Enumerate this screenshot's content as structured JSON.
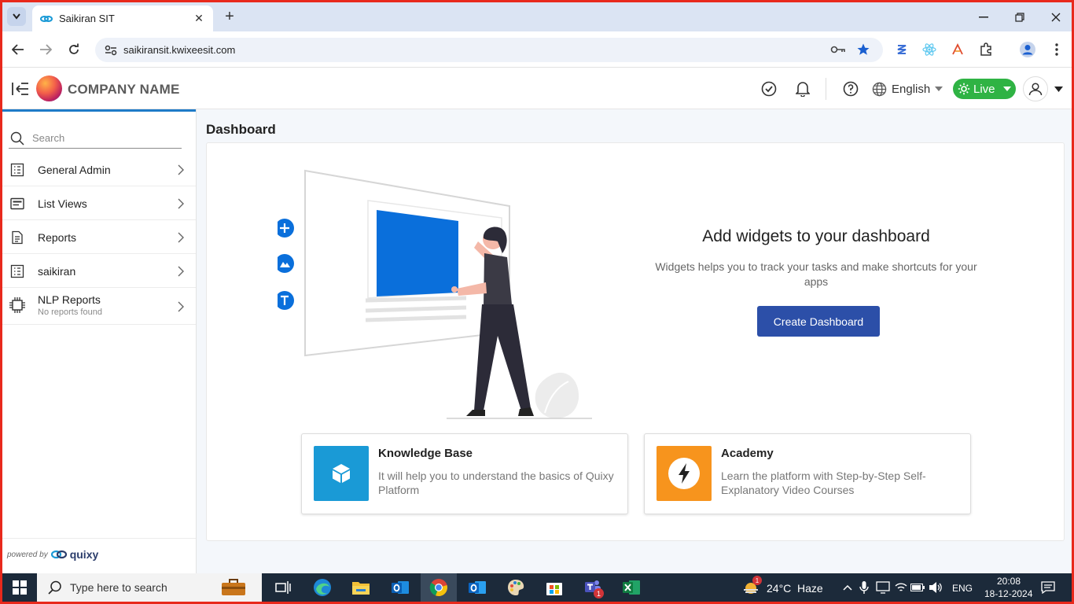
{
  "browser": {
    "tab_title": "Saikiran SIT",
    "url": "saikiransit.kwixeesit.com"
  },
  "header": {
    "company_name": "COMPANY NAME",
    "language": "English",
    "mode": "Live"
  },
  "sidebar": {
    "search_placeholder": "Search",
    "items": [
      {
        "label": "General Admin",
        "icon": "grid-list-icon"
      },
      {
        "label": "List Views",
        "icon": "list-view-icon"
      },
      {
        "label": "Reports",
        "icon": "document-icon"
      },
      {
        "label": "saikiran",
        "icon": "grid-list-icon"
      },
      {
        "label": "NLP Reports",
        "sub": "No reports found",
        "icon": "chip-icon"
      }
    ],
    "powered_by": "powered by",
    "brand": "quixy"
  },
  "main": {
    "page_title": "Dashboard",
    "hero_title": "Add widgets to your dashboard",
    "hero_subtitle": "Widgets helps you to track your tasks and make shortcuts for your apps",
    "create_button": "Create Dashboard",
    "cards": [
      {
        "title": "Knowledge Base",
        "desc": "It will help you to understand the basics of Quixy Platform",
        "color": "#1a9ad6"
      },
      {
        "title": "Academy",
        "desc": "Learn the platform with Step-by-Step Self-Explanatory Video Courses",
        "color": "#f7941d"
      }
    ]
  },
  "taskbar": {
    "search_placeholder": "Type here to search",
    "weather_temp": "24°C",
    "weather_desc": "Haze",
    "lang": "ENG",
    "time": "20:08",
    "date": "18-12-2024",
    "weather_badge": "1",
    "teams_badge": "1"
  },
  "colors": {
    "accent_blue": "#2c4fa8",
    "live_green": "#2fb344",
    "sidebar_accent": "#1f7bc8"
  }
}
